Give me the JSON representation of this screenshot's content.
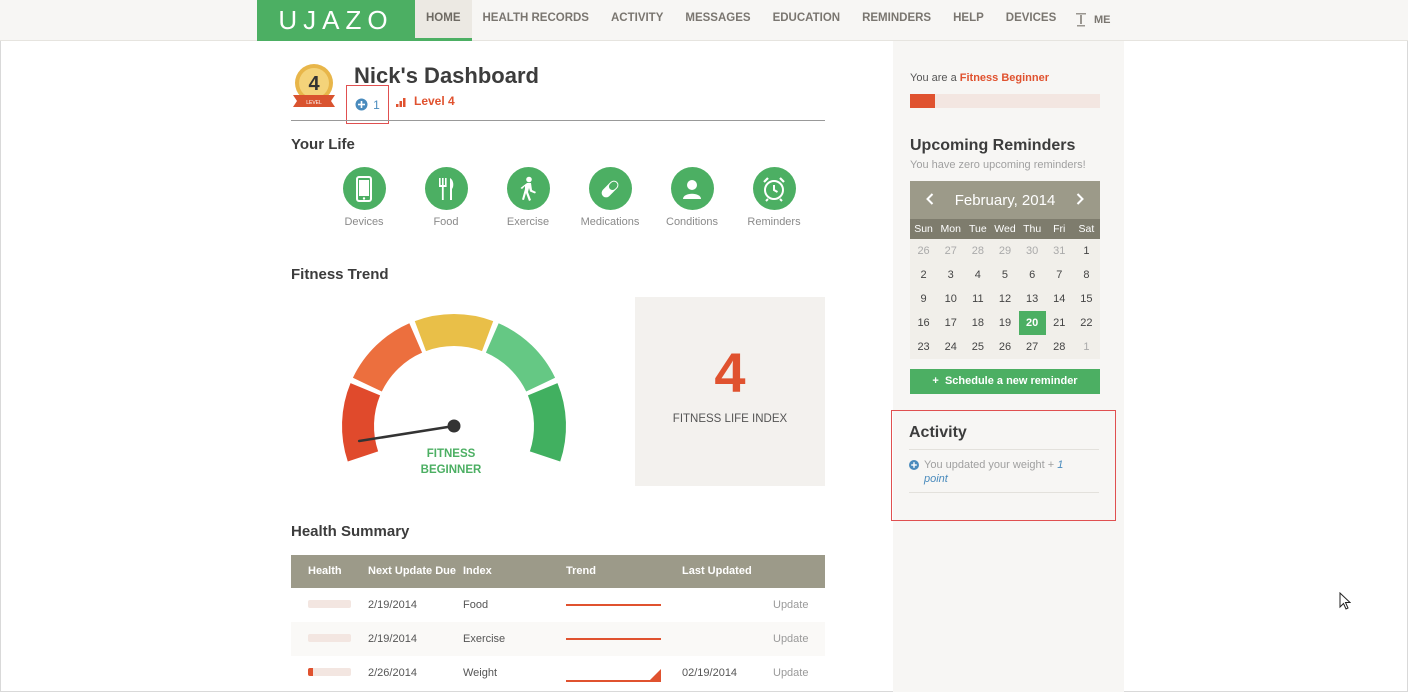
{
  "header": {
    "logo": "UJAZO",
    "nav": [
      "HOME",
      "HEALTH RECORDS",
      "ACTIVITY",
      "MESSAGES",
      "EDUCATION",
      "REMINDERS",
      "HELP",
      "DEVICES"
    ],
    "me_label": "ME"
  },
  "dashboard": {
    "title": "Nick's Dashboard",
    "level_badge_number": "4",
    "level_badge_ribbon": "LEVEL",
    "points": "1",
    "level_label": "Level 4"
  },
  "your_life": {
    "heading": "Your Life",
    "items": [
      {
        "label": "Devices",
        "icon": "phone-icon"
      },
      {
        "label": "Food",
        "icon": "fork-knife-icon"
      },
      {
        "label": "Exercise",
        "icon": "walking-icon"
      },
      {
        "label": "Medications",
        "icon": "pill-icon"
      },
      {
        "label": "Conditions",
        "icon": "person-icon"
      },
      {
        "label": "Reminders",
        "icon": "alarm-clock-icon"
      }
    ]
  },
  "fitness_trend": {
    "heading": "Fitness Trend",
    "gauge_label_line1": "FITNESS",
    "gauge_label_line2": "BEGINNER",
    "gauge_level_fraction": 0.05,
    "index_value": "4",
    "index_label": "FITNESS LIFE INDEX"
  },
  "health_summary": {
    "heading": "Health Summary",
    "columns": [
      "Health",
      "Next Update Due",
      "Index",
      "Trend",
      "Last Updated"
    ],
    "rows": [
      {
        "health_fraction": 0,
        "next_due": "2/19/2014",
        "index": "Food",
        "last_updated": "",
        "action": "Update"
      },
      {
        "health_fraction": 0,
        "next_due": "2/19/2014",
        "index": "Exercise",
        "last_updated": "",
        "action": "Update"
      },
      {
        "health_fraction": 0.12,
        "next_due": "2/26/2014",
        "index": "Weight",
        "last_updated": "02/19/2014",
        "action": "Update"
      }
    ]
  },
  "sidebar": {
    "fitness_prefix": "You are a ",
    "fitness_level": "Fitness Beginner",
    "fitness_progress_fraction": 0.13,
    "reminders_title": "Upcoming Reminders",
    "reminders_subtitle": "You have zero upcoming reminders!",
    "calendar": {
      "month_label": "February, 2014",
      "days_of_week": [
        "Sun",
        "Mon",
        "Tue",
        "Wed",
        "Thu",
        "Fri",
        "Sat"
      ],
      "days": [
        "26",
        "27",
        "28",
        "29",
        "30",
        "31",
        "1",
        "2",
        "3",
        "4",
        "5",
        "6",
        "7",
        "8",
        "9",
        "10",
        "11",
        "12",
        "13",
        "14",
        "15",
        "16",
        "17",
        "18",
        "19",
        "20",
        "21",
        "22",
        "23",
        "24",
        "25",
        "26",
        "27",
        "28",
        "1"
      ],
      "muted_indices": [
        0,
        1,
        2,
        3,
        4,
        5,
        34
      ],
      "today_index": 25
    },
    "schedule_button": "Schedule a new reminder",
    "activity_title": "Activity",
    "activity_item_text": "You updated your weight + ",
    "activity_item_points": "1 point"
  },
  "colors": {
    "brand_green": "#4caf63",
    "accent_orange": "#e0522f",
    "header_gray": "#9c9a89"
  }
}
